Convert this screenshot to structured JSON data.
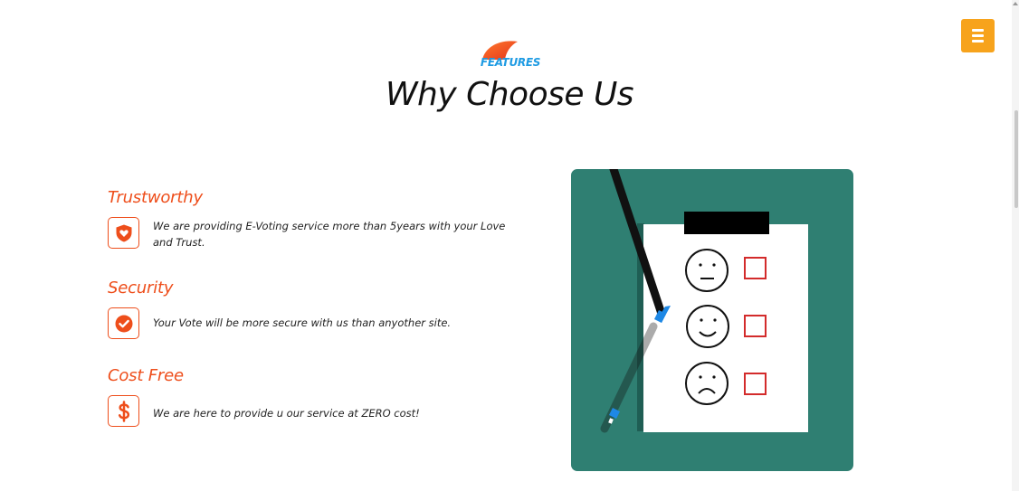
{
  "header": {
    "eyebrow": "FEATURES",
    "title": "Why Choose Us"
  },
  "features": [
    {
      "title": "Trustworthy",
      "icon": "shield-heart-icon",
      "description": "We are providing E-Voting service more than 5years with your Love and Trust."
    },
    {
      "title": "Security",
      "icon": "check-circle-icon",
      "description": "Your Vote will be more secure with us than anyother site."
    },
    {
      "title": "Cost Free",
      "icon": "dollar-icon",
      "description": "We are here to provide u our service at ZERO cost!"
    }
  ],
  "nav": {
    "menu_icon": "hamburger-menu-icon"
  },
  "colors": {
    "accent": "#ee4e1b",
    "eyebrow": "#1e9be3",
    "menu_button": "#f7a31c",
    "illustration_bg": "#2f7f72"
  }
}
